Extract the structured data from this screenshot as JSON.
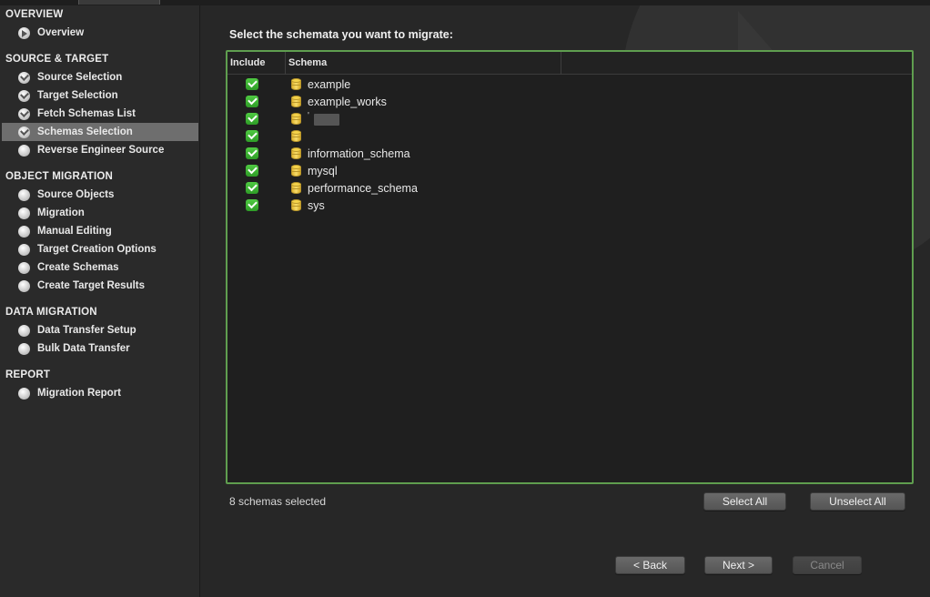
{
  "sidebar": {
    "sections": [
      {
        "title": "OVERVIEW",
        "items": [
          {
            "label": "Overview",
            "state": "arrow"
          }
        ]
      },
      {
        "title": "SOURCE & TARGET",
        "items": [
          {
            "label": "Source Selection",
            "state": "done"
          },
          {
            "label": "Target Selection",
            "state": "done"
          },
          {
            "label": "Fetch Schemas List",
            "state": "done"
          },
          {
            "label": "Schemas Selection",
            "state": "current"
          },
          {
            "label": "Reverse Engineer Source",
            "state": "pending"
          }
        ]
      },
      {
        "title": "OBJECT MIGRATION",
        "items": [
          {
            "label": "Source Objects",
            "state": "pending"
          },
          {
            "label": "Migration",
            "state": "pending"
          },
          {
            "label": "Manual Editing",
            "state": "pending"
          },
          {
            "label": "Target Creation Options",
            "state": "pending"
          },
          {
            "label": "Create Schemas",
            "state": "pending"
          },
          {
            "label": "Create Target Results",
            "state": "pending"
          }
        ]
      },
      {
        "title": "DATA MIGRATION",
        "items": [
          {
            "label": "Data Transfer Setup",
            "state": "pending"
          },
          {
            "label": "Bulk Data Transfer",
            "state": "pending"
          }
        ]
      },
      {
        "title": "REPORT",
        "items": [
          {
            "label": "Migration Report",
            "state": "pending"
          }
        ]
      }
    ]
  },
  "main": {
    "heading": "Select the schemata you want to migrate:",
    "table": {
      "columns": [
        "Include",
        "Schema"
      ],
      "rows": [
        {
          "include": true,
          "name": "example"
        },
        {
          "include": true,
          "name": "example_works"
        },
        {
          "include": true,
          "name": "",
          "redacted": true,
          "tick": "'"
        },
        {
          "include": true,
          "name": ""
        },
        {
          "include": true,
          "name": "information_schema"
        },
        {
          "include": true,
          "name": "mysql"
        },
        {
          "include": true,
          "name": "performance_schema"
        },
        {
          "include": true,
          "name": "sys"
        }
      ]
    },
    "status": "8 schemas selected",
    "select_all_label": "Select All",
    "unselect_all_label": "Unselect All"
  },
  "footer": {
    "back_label": "< Back",
    "next_label": "Next >",
    "cancel_label": "Cancel"
  },
  "colors": {
    "accent_border": "#5f9e4f",
    "checkbox_green": "#3fb835",
    "active_nav": "#6e6e6e"
  }
}
